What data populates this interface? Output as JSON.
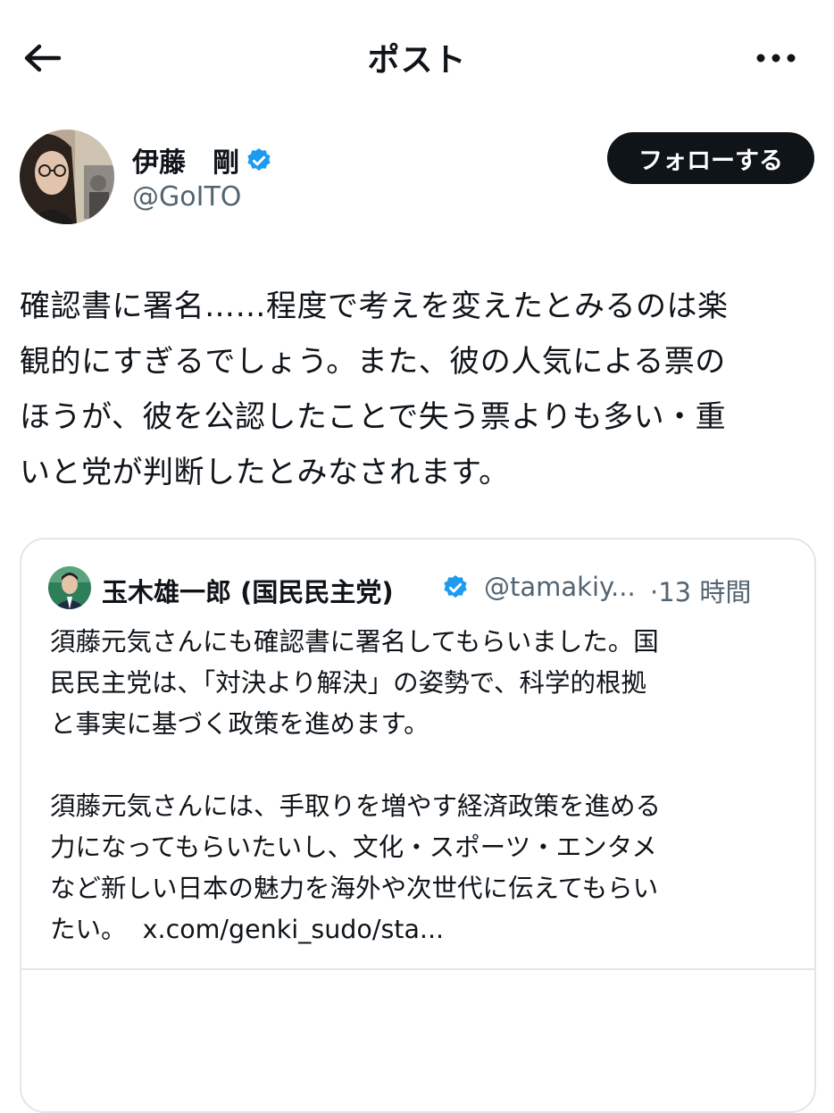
{
  "header": {
    "title": "ポスト",
    "back_icon": "arrow-left-icon",
    "more_icon": "more-horizontal-icon"
  },
  "author": {
    "display_name": "伊藤　剛",
    "handle": "@GoITO",
    "verified_color": "#1d9bf0",
    "follow_label": "フォローする"
  },
  "post": {
    "lines": [
      "確認書に署名……程度で考えを変えたとみるのは楽",
      "観的にすぎるでしょう。また、彼の人気による票の",
      "ほうが、彼を公認したことで失う票よりも多い・重",
      "いと党が判断したとみなされます。"
    ]
  },
  "quote": {
    "name": "玉木雄一郎 (国民民主党)",
    "handle": "@tamakiy...",
    "separator": "·",
    "time": "13 時間",
    "paragraph1": [
      "須藤元気さんにも確認書に署名してもらいました。国",
      "民民主党は、「対決より解決」の姿勢で、科学的根拠",
      "と事実に基づく政策を進めます。"
    ],
    "paragraph2": [
      "須藤元気さんには、手取りを増やす経済政策を進める",
      "力になってもらいたいし、文化・スポーツ・エンタメ",
      "など新しい日本の魅力を海外や次世代に伝えてもらい"
    ],
    "last_line_text": "たい。",
    "link": "x.com/genki_sudo/sta..."
  },
  "colors": {
    "text": "#0f1419",
    "secondary": "#536471",
    "border": "#e1e6ea",
    "accent": "#1d9bf0"
  }
}
